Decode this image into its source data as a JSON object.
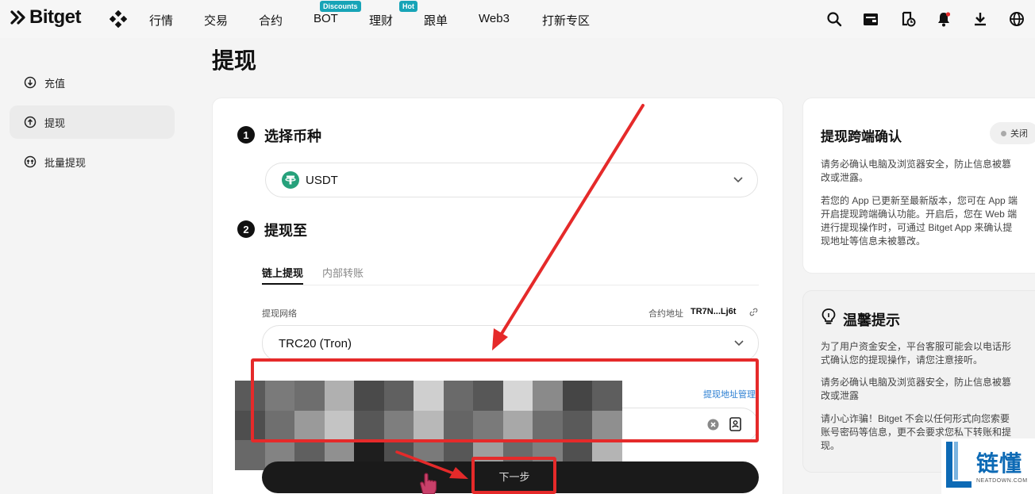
{
  "brand": {
    "name": "Bitget"
  },
  "nav": {
    "items": [
      "行情",
      "交易",
      "合约",
      "BOT",
      "理财",
      "跟单",
      "Web3",
      "打新专区"
    ],
    "badges": {
      "bot": "Discounts",
      "licai": "Hot"
    }
  },
  "sidebar": {
    "items": [
      {
        "label": "充值",
        "icon": "deposit-icon"
      },
      {
        "label": "提现",
        "icon": "withdraw-icon"
      },
      {
        "label": "批量提现",
        "icon": "batch-withdraw-icon"
      }
    ]
  },
  "page": {
    "title": "提现"
  },
  "form": {
    "step1": {
      "num": "1",
      "title": "选择币种",
      "coin": "USDT"
    },
    "step2": {
      "num": "2",
      "title": "提现至"
    },
    "tabs": [
      "链上提现",
      "内部转账"
    ],
    "network_label": "提现网络",
    "contract_label": "合约地址",
    "contract_value": "TR7N...Lj6t",
    "network_value": "TRC20 (Tron)",
    "address_manage": "提现地址管理",
    "next_button": "下一步"
  },
  "confirm_panel": {
    "title": "提现跨端确认",
    "toggle_label": "关闭",
    "p1": [
      "请务必确认电脑及浏览器安全，防止信息被篡",
      "改或泄露。"
    ],
    "p2": [
      "若您的 App 已更新至最新版本，您可在 App 端",
      "开启提现跨端确认功能。开启后，您在 Web 端",
      "进行提现操作时，可通过 Bitget App 来确认提",
      "现地址等信息未被篡改。"
    ]
  },
  "tips_panel": {
    "title": "温馨提示",
    "p1": [
      "为了用户资金安全，平台客服可能会以电话形",
      "式确认您的提现操作，请您注意接听。"
    ],
    "p2": [
      "请务必确认电脑及浏览器安全，防止信息被篡",
      "改或泄露"
    ],
    "p3": [
      "请小心诈骗！Bitget 不会以任何形式向您索要",
      "账号密码等信息，更不会要求您私下转账和提",
      "现。"
    ]
  },
  "watermark": {
    "main": "链懂",
    "sub": "NEATDOWN.COM"
  },
  "colors": {
    "annotation": "#e52a2a",
    "tron_green": "#26a17b",
    "watermark_blue": "#0d6ab5"
  }
}
